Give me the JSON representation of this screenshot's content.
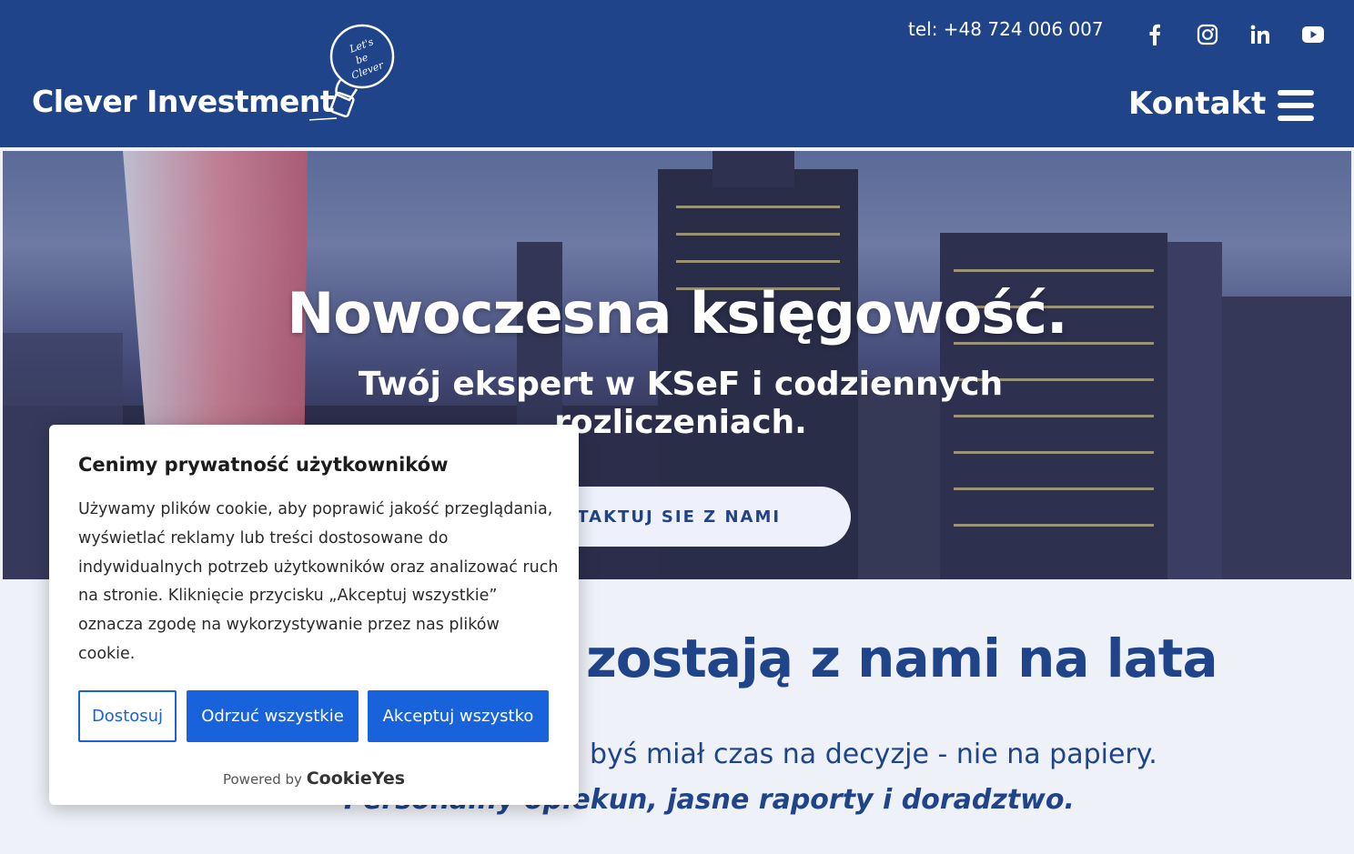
{
  "header": {
    "logo_text": "Clever Investment",
    "logo_tagline": "Let's be Clever",
    "phone": "tel: +48 724 006 007",
    "social_icons": [
      "facebook-icon",
      "instagram-icon",
      "linkedin-icon",
      "youtube-icon"
    ],
    "menu_label": "Kontakt"
  },
  "hero": {
    "title": "Nowoczesna księgowość.",
    "subtitle": "Twój ekspert w KSeF i codziennych rozliczeniach.",
    "cta": "ONTAKTUJ SIE Z NAMI"
  },
  "section": {
    "title": "zostają z nami na lata",
    "text": "byś miał czas na decyzje - nie na papiery.",
    "italic": "Personalny opiekun, jasne raporty i doradztwo."
  },
  "cookie": {
    "title": "Cenimy prywatność użytkowników",
    "body": "Używamy plików cookie, aby poprawić jakość przeglądania, wyświetlać reklamy lub treści dostosowane do indywidualnych potrzeb użytkowników oraz analizować ruch na stronie. Kliknięcie przycisku „Akceptuj wszystkie” oznacza zgodę na wykorzystywanie przez nas plików cookie.",
    "btn_customize": "Dostosuj",
    "btn_reject": "Odrzuć wszystkie",
    "btn_accept": "Akceptuj wszystko",
    "powered_by": "Powered by",
    "brand": "CookieYes"
  },
  "colors": {
    "header_bg": "#1f4489",
    "accent": "#1863dc",
    "brand_text": "#1f4489"
  }
}
